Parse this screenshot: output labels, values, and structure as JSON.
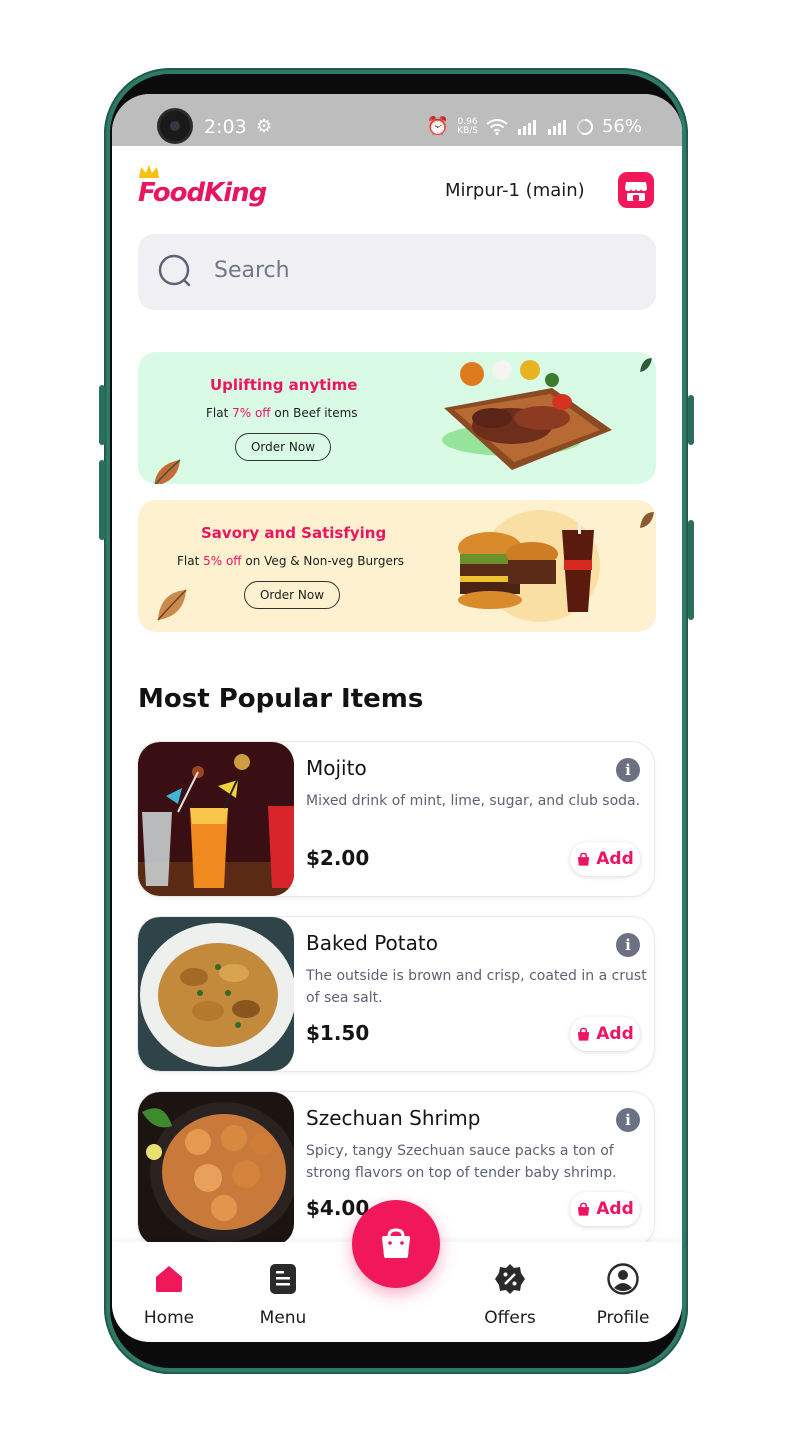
{
  "status_bar": {
    "time": "2:03",
    "network_speed": "0.96",
    "network_unit": "KB/S",
    "battery": "56%"
  },
  "header": {
    "logo": "FoodKing",
    "branch": "Mirpur-1 (main)"
  },
  "search": {
    "placeholder": "Search"
  },
  "banners": [
    {
      "title": "Uplifting anytime",
      "sub_prefix": "Flat ",
      "percent": "7% off",
      "sub_suffix": " on Beef items",
      "button": "Order Now"
    },
    {
      "title": "Savory and Satisfying",
      "sub_prefix": "Flat ",
      "percent": "5% off",
      "sub_suffix": " on Veg & Non-veg Burgers",
      "button": "Order Now"
    }
  ],
  "section_title": "Most Popular Items",
  "items": [
    {
      "name": "Mojito",
      "description": "Mixed drink of mint, lime, sugar, and club soda.",
      "price": "$2.00",
      "add_label": "Add"
    },
    {
      "name": "Baked Potato",
      "description": "The outside is brown and crisp, coated in a crust of sea salt.",
      "price": "$1.50",
      "add_label": "Add"
    },
    {
      "name": "Szechuan Shrimp",
      "description": "Spicy, tangy Szechuan sauce packs a ton of strong flavors on top of tender baby shrimp.",
      "price": "$4.00",
      "add_label": "Add"
    }
  ],
  "bottom_nav": [
    {
      "label": "Home",
      "icon": "home-icon",
      "active": true
    },
    {
      "label": "Menu",
      "icon": "menu-icon",
      "active": false
    },
    {
      "label": "Offers",
      "icon": "offers-icon",
      "active": false
    },
    {
      "label": "Profile",
      "icon": "profile-icon",
      "active": false
    }
  ],
  "colors": {
    "brand": "#ec1561",
    "frame": "#2f7a66",
    "search_bg": "#efeff4",
    "banner1_bg": "#d9fbe5",
    "banner2_bg": "#fdf1cf"
  }
}
